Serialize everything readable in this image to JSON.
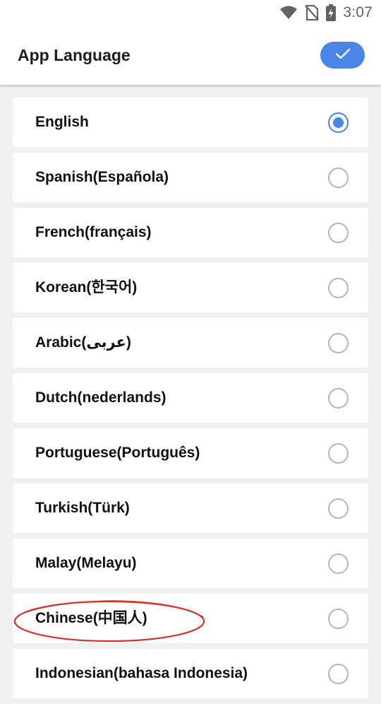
{
  "status_bar": {
    "time": "3:07",
    "icons": [
      "wifi-icon",
      "no-sim-icon",
      "battery-charging-icon"
    ]
  },
  "header": {
    "title": "App Language",
    "confirm_icon": "check-icon"
  },
  "languages": [
    {
      "label": "English",
      "selected": true
    },
    {
      "label": "Spanish(Española)",
      "selected": false
    },
    {
      "label": "French(français)",
      "selected": false
    },
    {
      "label": "Korean(한국어)",
      "selected": false
    },
    {
      "label": "Arabic(عربى)",
      "selected": false
    },
    {
      "label": "Dutch(nederlands)",
      "selected": false
    },
    {
      "label": "Portuguese(Português)",
      "selected": false
    },
    {
      "label": "Turkish(Türk)",
      "selected": false
    },
    {
      "label": "Malay(Melayu)",
      "selected": false
    },
    {
      "label": "Chinese(中国人)",
      "selected": false
    },
    {
      "label": "Indonesian(bahasa Indonesia)",
      "selected": false
    }
  ],
  "colors": {
    "accent": "#4a86e8",
    "annotation": "#d9302c",
    "background": "#f0f0f0"
  }
}
